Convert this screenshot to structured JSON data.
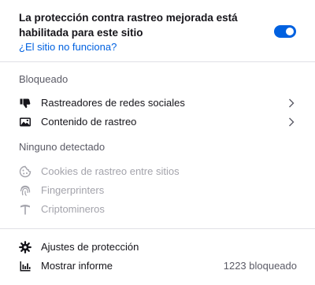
{
  "header": {
    "title": "La protección contra rastreo mejorada está habilitada para este sitio",
    "broken_site_link": "¿El sitio no funciona?",
    "toggle_on": true,
    "accent_color": "#0061e0"
  },
  "blocked": {
    "heading": "Bloqueado",
    "items": [
      {
        "label": "Rastreadores de redes sociales",
        "icon": "thumbs-down-icon"
      },
      {
        "label": "Contenido de rastreo",
        "icon": "image-icon"
      }
    ]
  },
  "none_detected": {
    "heading": "Ninguno detectado",
    "items": [
      {
        "label": "Cookies de rastreo entre sitios",
        "icon": "cookie-icon"
      },
      {
        "label": "Fingerprinters",
        "icon": "fingerprint-icon"
      },
      {
        "label": "Criptomineros",
        "icon": "pickaxe-icon"
      }
    ]
  },
  "footer": {
    "settings_label": "Ajustes de protección",
    "settings_icon": "gear-icon",
    "report_label": "Mostrar informe",
    "report_icon": "bar-chart-icon",
    "blocked_count": "1223 bloqueado"
  }
}
